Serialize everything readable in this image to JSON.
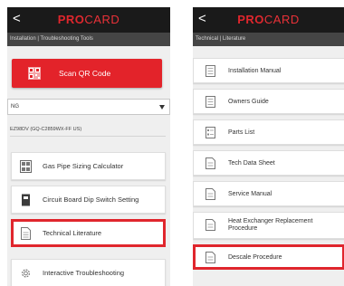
{
  "left": {
    "back_glyph": "<",
    "brand_pro": "PRO",
    "brand_card": "CARD",
    "breadcrumb": "Installation | Troubleshooting Tools",
    "scan_label": "Scan QR Code",
    "fuel_select": "NG",
    "model": "EZ98DV (GQ-C2859WX-FF US)",
    "tiles": [
      {
        "label": "Gas Pipe Sizing Calculator",
        "icon": "calculator-icon"
      },
      {
        "label": "Circuit Board Dip Switch Setting",
        "icon": "dip-switch-icon"
      },
      {
        "label": "Technical Literature",
        "icon": "document-icon",
        "highlighted": true
      },
      {
        "label": "Interactive Troubleshooting",
        "icon": "gear-icon"
      }
    ]
  },
  "right": {
    "back_glyph": "<",
    "brand_pro": "PRO",
    "brand_card": "CARD",
    "breadcrumb": "Technical | Literature",
    "items": [
      {
        "label": "Installation Manual",
        "icon": "book-icon"
      },
      {
        "label": "Owners Guide",
        "icon": "book-icon"
      },
      {
        "label": "Parts List",
        "icon": "list-icon"
      },
      {
        "label": "Tech Data Sheet",
        "icon": "document-icon"
      },
      {
        "label": "Service Manual",
        "icon": "document-icon"
      },
      {
        "label": "Heat Exchanger Replacement Procedure",
        "icon": "document-icon"
      },
      {
        "label": "Descale Procedure",
        "icon": "document-icon",
        "highlighted": true
      }
    ]
  },
  "colors": {
    "brand_red": "#e0262d",
    "header_dark": "#1a1a1a",
    "subheader_gray": "#454545",
    "highlight_border": "#e0262d"
  }
}
